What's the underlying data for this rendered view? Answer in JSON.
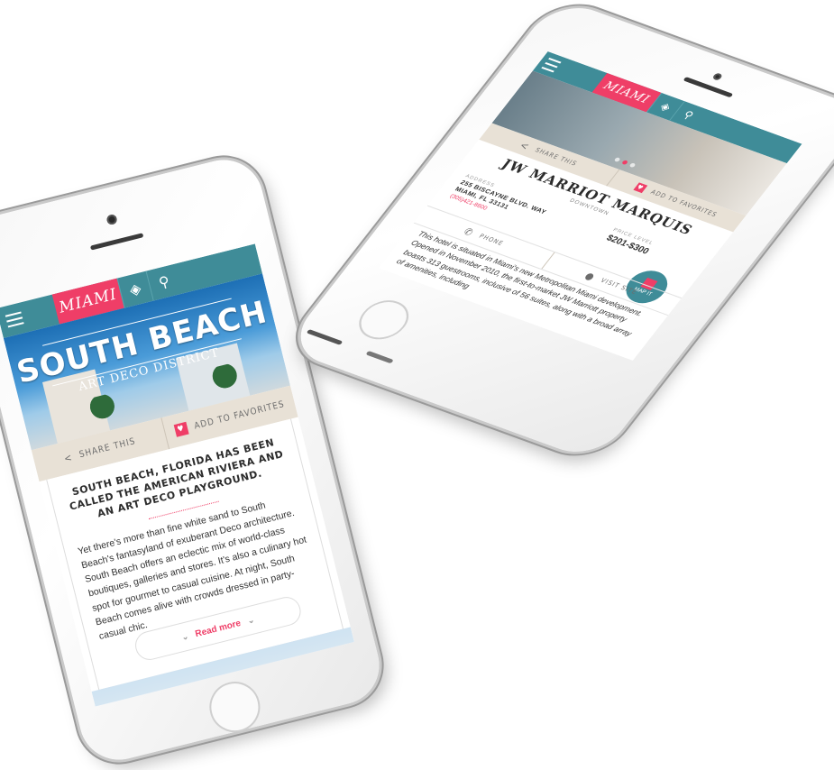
{
  "left_phone": {
    "header": {
      "logo": "MIAMI"
    },
    "hero": {
      "title": "SOUTH BEACH",
      "subtitle": "ART DECO DISTRICT"
    },
    "actions": {
      "share": "SHARE THIS",
      "favorite": "ADD TO FAVORITES"
    },
    "article": {
      "headline": "SOUTH BEACH, FLORIDA HAS BEEN CALLED THE AMERICAN RIVIERA AND AN ART DECO PLAYGROUND.",
      "body": "Yet there's more than fine white sand to South Beach's fantasyland of exuberant Deco architecture. South Beach offers an eclectic mix of world-class boutiques, galleries and stores. It's also a culinary hot spot for gourmet to casual cuisine. At night, South Beach comes alive with crowds dressed in party-casual chic.",
      "read_more": "Read more"
    }
  },
  "right_phone": {
    "header": {
      "logo": "MIAMI"
    },
    "actions": {
      "share": "SHARE THIS",
      "favorite": "ADD TO FAVORITES"
    },
    "hotel": {
      "name": "JW MARRIOT MARQUIS",
      "area": "DOWNTOWN",
      "address_label": "ADDRESS",
      "address_line1": "255 BISCAYNE BLVD. WAY",
      "address_line2": "MIAMI, FL 33131",
      "phone_number": "(305)421-8600",
      "price_label": "PRICE LEVEL",
      "price": "$201-$300",
      "phone_link": "PHONE",
      "visit_link": "VISIT SITE",
      "map_label": "MAP IT",
      "body": "This hotel is situated in Miami's new Metropolitan Miami development. Opened in November 2010, the first-to-market JW Marriott property boasts 313 guestrooms, inclusive of 56 suites, along with a broad array of amenities, including"
    }
  },
  "colors": {
    "teal": "#3f8c98",
    "pink": "#ef3e67",
    "sand": "#e8e1d6"
  }
}
